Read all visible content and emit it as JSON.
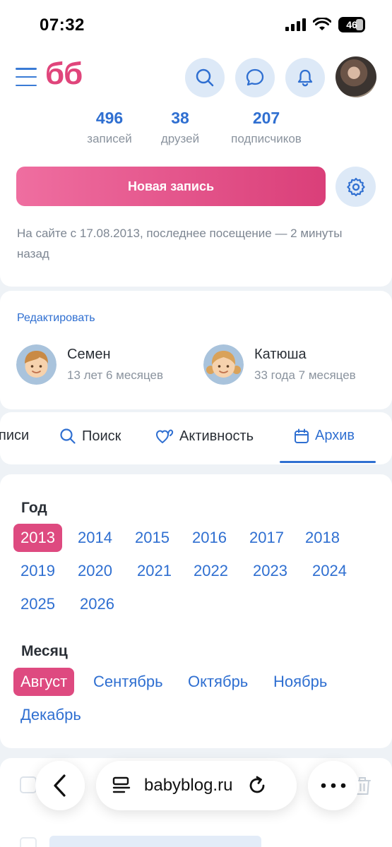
{
  "status": {
    "time": "07:32",
    "battery": "46"
  },
  "header": {
    "logo": "бб"
  },
  "profile": {
    "stats": [
      {
        "value": "496",
        "label": "записей"
      },
      {
        "value": "38",
        "label": "друзей"
      },
      {
        "value": "207",
        "label": "подписчиков"
      }
    ],
    "new_post_label": "Новая запись",
    "site_info": "На сайте с 17.08.2013, последнее посещение — 2 минуты назад"
  },
  "children": {
    "edit_label": "Редактировать",
    "items": [
      {
        "name": "Семен",
        "age": "13 лет 6 месяцев"
      },
      {
        "name": "Катюша",
        "age": "33 года 7 месяцев"
      }
    ]
  },
  "tabs": [
    {
      "label": "писи"
    },
    {
      "label": "Поиск"
    },
    {
      "label": "Активность"
    },
    {
      "label": "Архив"
    }
  ],
  "archive": {
    "year_title": "Год",
    "years": [
      "2013",
      "2014",
      "2015",
      "2016",
      "2017",
      "2018",
      "2019",
      "2020",
      "2021",
      "2022",
      "2023",
      "2024",
      "2025",
      "2026"
    ],
    "selected_year": "2013",
    "month_title": "Месяц",
    "months": [
      "Август",
      "Сентябрь",
      "Октябрь",
      "Ноябрь",
      "Декабрь"
    ],
    "selected_month": "Август"
  },
  "browser": {
    "url": "babyblog.ru"
  },
  "colors": {
    "accent_blue": "#2f6fd1",
    "accent_pink": "#de4a80"
  }
}
